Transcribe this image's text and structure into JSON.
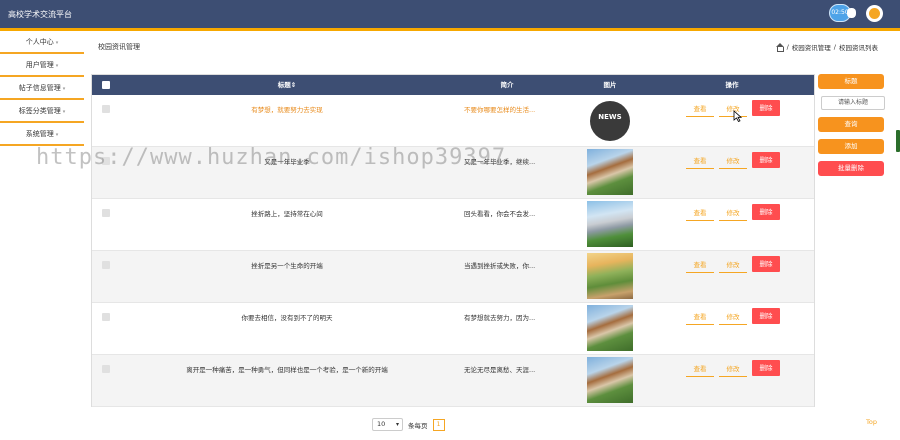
{
  "header": {
    "app_title": "高校学术交流平台",
    "time_badge": "02:50"
  },
  "sidebar": {
    "items": [
      {
        "label": "个人中心"
      },
      {
        "label": "用户管理"
      },
      {
        "label": "帖子信息管理"
      },
      {
        "label": "标签分类管理"
      },
      {
        "label": "系统管理"
      }
    ]
  },
  "page": {
    "title": "校园资讯管理",
    "breadcrumb": [
      "校园资讯管理",
      "校园资讯列表"
    ],
    "separator": "/"
  },
  "table": {
    "columns": [
      "标题⇕",
      "简介",
      "图片",
      "操作"
    ],
    "rows": [
      {
        "title": "有梦想，就要努力去实现",
        "intro": "不要你哪要怎样的生活...",
        "image": "news",
        "highlighted": true
      },
      {
        "title": "又是一年毕业季",
        "intro": "又是一年毕业季，继续...",
        "image": "campus"
      },
      {
        "title": "挫折路上，坚持常在心间",
        "intro": "回头看看，你会不会发...",
        "image": "campus2"
      },
      {
        "title": "挫折是另一个生命的开端",
        "intro": "当遇到挫折或失败，你...",
        "image": "campus3"
      },
      {
        "title": "你要去相信，没有到不了的明天",
        "intro": "有梦想就去努力，因为...",
        "image": "campus"
      },
      {
        "title": "离开是一种痛苦，是一种勇气，但同样也是一个考验，是一个新的开端",
        "intro": "无论无尽是离愁、天涯...",
        "image": "campus"
      }
    ],
    "actions": {
      "view": "查看",
      "edit": "修改",
      "delete": "删除"
    },
    "news_label": "NEWS"
  },
  "right_panel": {
    "title_label": "标题",
    "search_placeholder": "请输入标题",
    "search_button": "查询",
    "add_button": "添加",
    "batch_delete_button": "批量删除"
  },
  "pager": {
    "page_size": "10",
    "per_page_label": "条每页",
    "current_page": "1"
  },
  "top_link": "Top",
  "watermark": "https://www.huzhan.com/ishop39397"
}
